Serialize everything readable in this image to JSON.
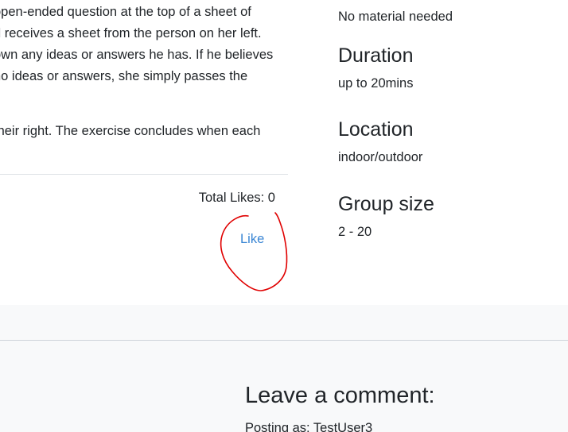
{
  "activity": {
    "description_lines": [
      "open-ended question at the top of a sheet of",
      "d receives a sheet from the person on her left.",
      "own any ideas or answers he has. If he believes",
      " no ideas or answers, she simply passes the",
      "their right. The exercise concludes when each"
    ]
  },
  "likes": {
    "total_label": "Total Likes: 0",
    "like_label": "Like"
  },
  "annotation": {
    "color": "#e00000"
  },
  "sidebar": {
    "material_value": "No material needed",
    "duration_heading": "Duration",
    "duration_value": "up to 20mins",
    "location_heading": "Location",
    "location_value": "indoor/outdoor",
    "group_heading": "Group size",
    "group_value": "2 - 20"
  },
  "comments": {
    "title": "Leave a comment:",
    "posting_as": "Posting as: TestUser3"
  },
  "colors": {
    "link": "#3a86d4",
    "text": "#212529",
    "band": "#f8f9fa"
  }
}
